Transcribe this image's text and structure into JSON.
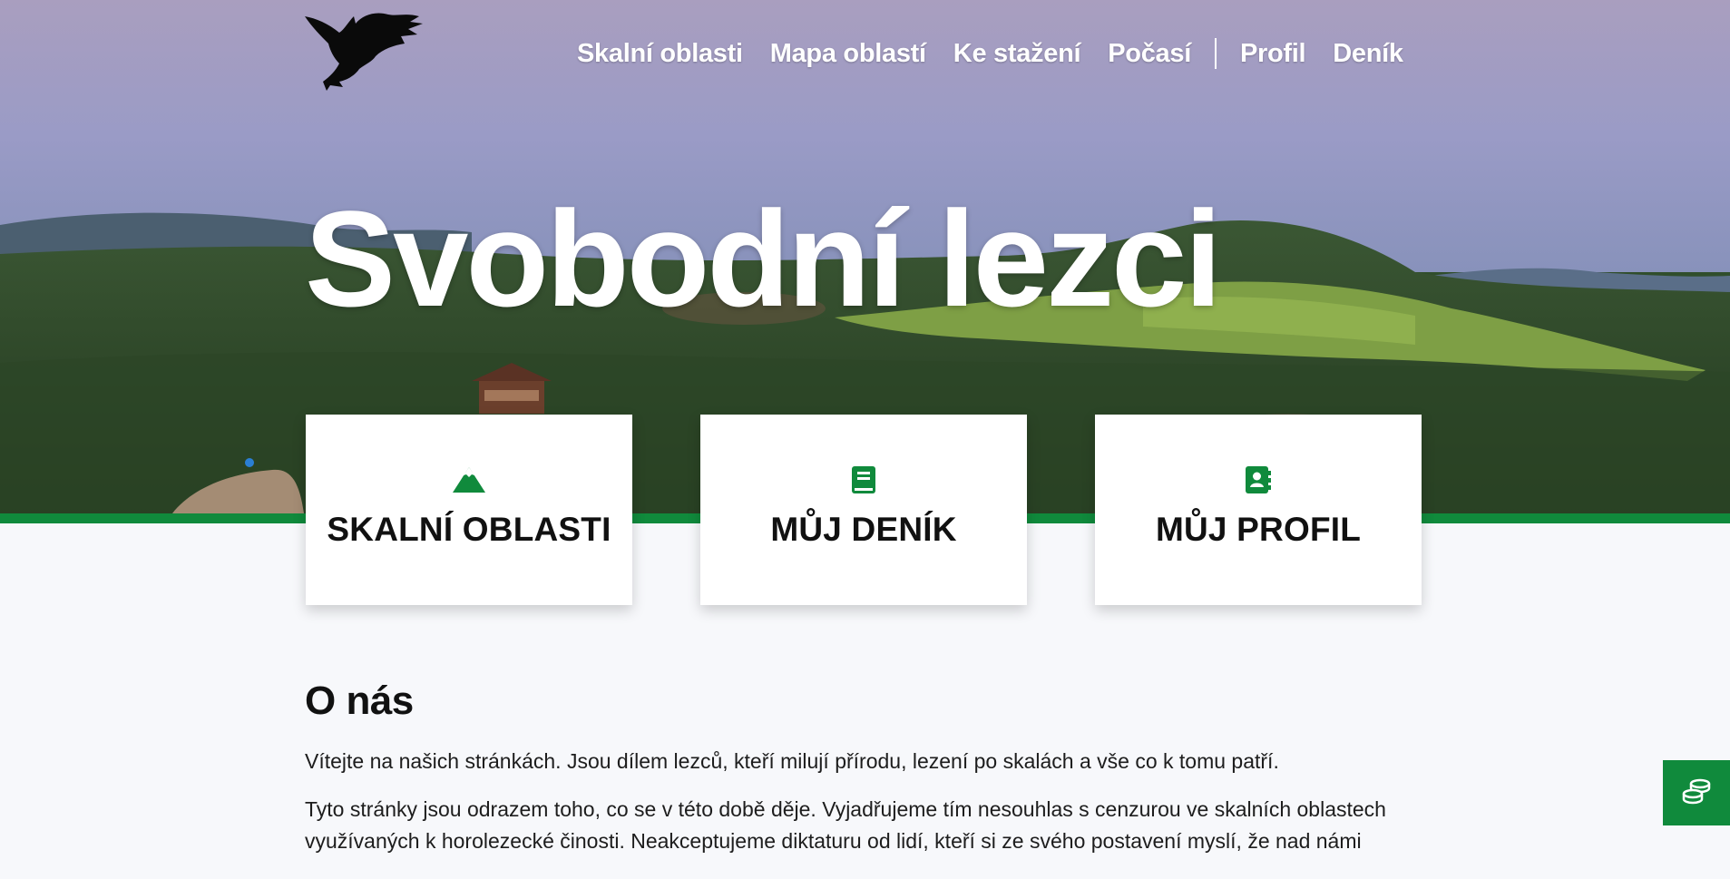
{
  "nav": {
    "items": [
      {
        "label": "Skalní oblasti"
      },
      {
        "label": "Mapa oblastí"
      },
      {
        "label": "Ke stažení"
      },
      {
        "label": "Počasí"
      },
      {
        "label": "Profil"
      },
      {
        "label": "Deník"
      }
    ]
  },
  "hero": {
    "title": "Svobodní lezci"
  },
  "cards": [
    {
      "label": "SKALNÍ OBLASTI",
      "icon": "mountain-icon"
    },
    {
      "label": "MŮJ DENÍK",
      "icon": "book-icon"
    },
    {
      "label": "MŮJ PROFIL",
      "icon": "contact-book-icon"
    }
  ],
  "about": {
    "heading": "O nás",
    "paragraph1": "Vítejte na našich stránkách. Jsou dílem lezců, kteří milují přírodu, lezení po skalách a vše co k tomu patří.",
    "paragraph2": "Tyto stránky jsou odrazem toho, co se v této době děje. Vyjadřujeme tím nesouhlas s cenzurou ve skalních oblastech využívaných k horolezecké činosti. Neakceptujeme diktaturu od lidí, kteří si ze svého postavení myslí, že nad námi"
  },
  "floating_button": {
    "icon": "coins-icon"
  },
  "colors": {
    "accent": "#108a3c",
    "background": "#f7f8fb",
    "card": "#ffffff"
  }
}
